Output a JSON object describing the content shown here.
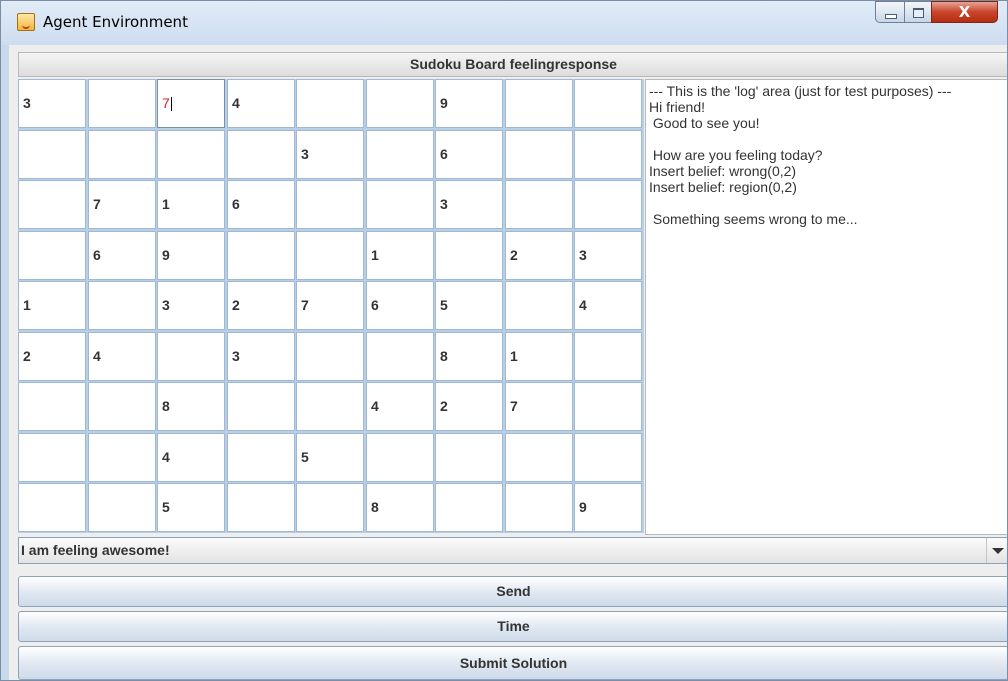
{
  "window": {
    "title": "Agent Environment",
    "close_label": "X"
  },
  "board": {
    "header": "Sudoku Board feelingresponse",
    "rows": [
      [
        "3",
        "",
        "7",
        "4",
        "",
        "",
        "9",
        "",
        ""
      ],
      [
        "",
        "",
        "",
        "",
        "3",
        "",
        "6",
        "",
        ""
      ],
      [
        "",
        "7",
        "1",
        "6",
        "",
        "",
        "3",
        "",
        ""
      ],
      [
        "",
        "6",
        "9",
        "",
        "",
        "1",
        "",
        "2",
        "3"
      ],
      [
        "1",
        "",
        "3",
        "2",
        "7",
        "6",
        "5",
        "",
        "4"
      ],
      [
        "2",
        "4",
        "",
        "3",
        "",
        "",
        "8",
        "1",
        ""
      ],
      [
        "",
        "",
        "8",
        "",
        "",
        "4",
        "2",
        "7",
        ""
      ],
      [
        "",
        "",
        "4",
        "",
        "5",
        "",
        "",
        "",
        ""
      ],
      [
        "",
        "",
        "5",
        "",
        "",
        "8",
        "",
        "",
        "9"
      ]
    ],
    "editing_cell": "7",
    "editing_color": "#e02020"
  },
  "log": {
    "lines": [
      "--- This is the 'log' area (just for test purposes) ---",
      "Hi friend!",
      " Good to see you!",
      "",
      " How are you feeling today?",
      "Insert belief: wrong(0,2)",
      "Insert belief: region(0,2)",
      "",
      " Something seems wrong to me..."
    ]
  },
  "response": {
    "selected": "I am feeling awesome!"
  },
  "buttons": {
    "send": "Send",
    "time": "Time",
    "submit": "Submit Solution"
  },
  "icons": [
    "app-icon",
    "minimize-icon",
    "maximize-icon",
    "close-icon",
    "dropdown-arrow-icon"
  ]
}
